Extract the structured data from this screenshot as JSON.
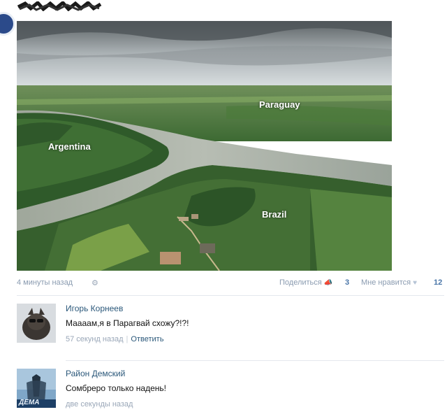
{
  "post": {
    "image_labels": {
      "paraguay": "Paraguay",
      "argentina": "Argentina",
      "brazil": "Brazil"
    },
    "time": "4 минуты назад",
    "share_label": "Поделиться",
    "share_count": "3",
    "like_label": "Мне нравится",
    "like_count": "12"
  },
  "comments": [
    {
      "author": "Игорь Корнеев",
      "text": "Маааам,я в Парагвай схожу?!?!",
      "time": "57 секунд назад",
      "reply_label": "Ответить"
    },
    {
      "author": "Район Демский",
      "text": "Сомбреро только надень!",
      "time": "две секунды назад",
      "avatar_text": "ДЕМА"
    }
  ],
  "icons": [
    "gear-icon",
    "share-icon",
    "heart-icon"
  ],
  "colors": {
    "link": "#2b587a",
    "meta": "#8a9bb0",
    "accent": "#4a76a8"
  }
}
